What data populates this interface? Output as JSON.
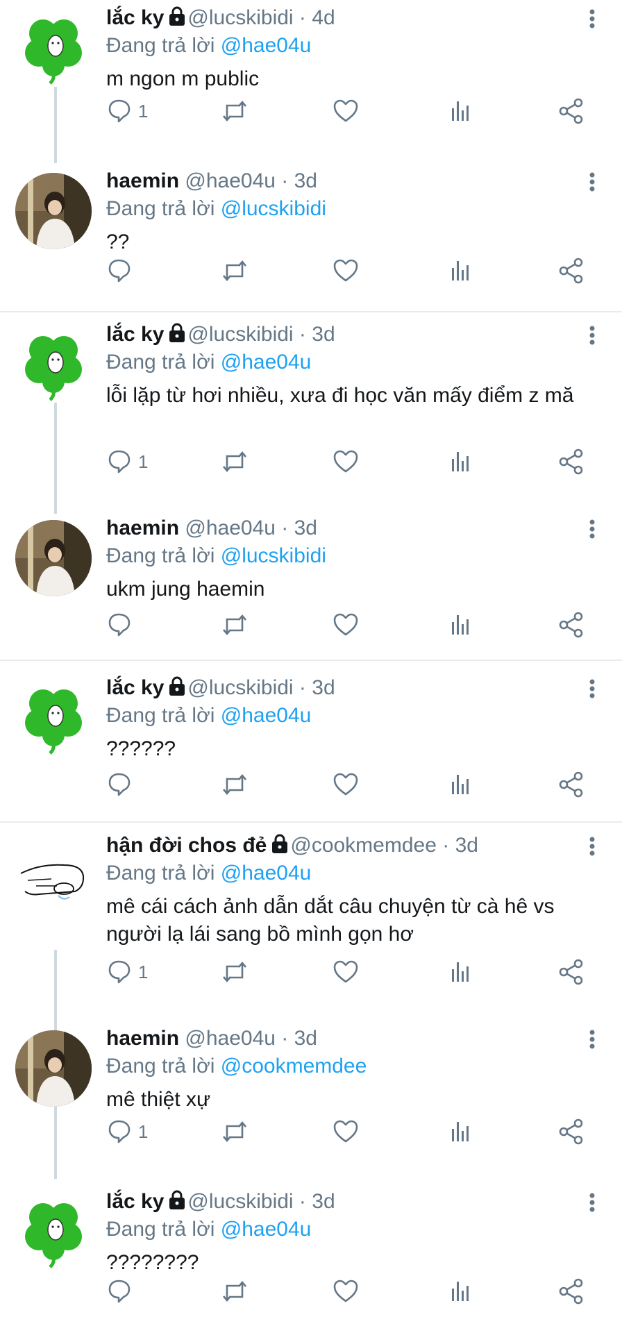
{
  "labels": {
    "replying_prefix": "Đang trả lời",
    "separator_dot": "·"
  },
  "colors": {
    "text": "#14171a",
    "secondary": "#657786",
    "accent": "#1da1f2",
    "thread_line": "#cfd9de",
    "divider": "#e6ecf0",
    "clover_green": "#2fb82a"
  },
  "action_icons": [
    "reply-icon",
    "retweet-icon",
    "like-icon",
    "analytics-icon",
    "share-icon"
  ],
  "tweets": [
    {
      "name": "lắc ky",
      "locked": true,
      "avatar": "clover",
      "handle": "@lucskibidi",
      "time": "4d",
      "reply_to": "@hae04u",
      "text": "m ngon m public",
      "reply_count": "1"
    },
    {
      "name": "haemin",
      "locked": false,
      "avatar": "photo",
      "handle": "@hae04u",
      "time": "3d",
      "reply_to": "@lucskibidi",
      "text": "??",
      "reply_count": ""
    },
    {
      "name": "lắc ky",
      "locked": true,
      "avatar": "clover",
      "handle": "@lucskibidi",
      "time": "3d",
      "reply_to": "@hae04u",
      "text": "lỗi lặp từ hơi nhiều, xưa đi học văn mấy điểm z mă",
      "reply_count": "1"
    },
    {
      "name": "haemin",
      "locked": false,
      "avatar": "photo",
      "handle": "@hae04u",
      "time": "3d",
      "reply_to": "@lucskibidi",
      "text": "ukm jung haemin",
      "reply_count": ""
    },
    {
      "name": "lắc ky",
      "locked": true,
      "avatar": "clover",
      "handle": "@lucskibidi",
      "time": "3d",
      "reply_to": "@hae04u",
      "text": "??????",
      "reply_count": ""
    },
    {
      "name": "hận đời chos đẻ",
      "locked": true,
      "avatar": "sketch",
      "handle": "@cookmemdee",
      "time": "3d",
      "reply_to": "@hae04u",
      "text": "mê cái cách ảnh dẫn dắt câu chuyện từ cà hê vs người lạ lái sang bồ mình gọn hơ",
      "reply_count": "1"
    },
    {
      "name": "haemin",
      "locked": false,
      "avatar": "photo",
      "handle": "@hae04u",
      "time": "3d",
      "reply_to": "@cookmemdee",
      "text": "mê thiệt xự",
      "reply_count": "1"
    },
    {
      "name": "lắc ky",
      "locked": true,
      "avatar": "clover",
      "handle": "@lucskibidi",
      "time": "3d",
      "reply_to": "@hae04u",
      "text": "????????",
      "reply_count": ""
    }
  ]
}
